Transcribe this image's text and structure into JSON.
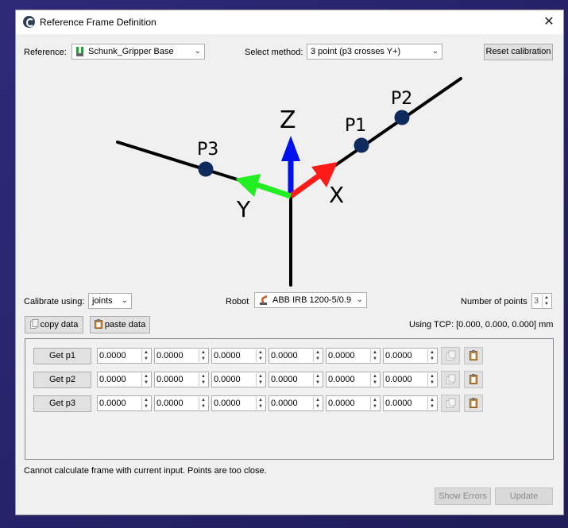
{
  "window": {
    "title": "Reference Frame Definition",
    "close_glyph": "✕"
  },
  "top": {
    "reference_label": "Reference:",
    "reference_value": "Schunk_Gripper Base",
    "method_label": "Select method:",
    "method_value": "3 point (p3 crosses Y+)",
    "reset_label": "Reset calibration"
  },
  "diagram": {
    "axis_labels": {
      "z": "Z",
      "x": "X",
      "y": "Y"
    },
    "point_labels": {
      "p1": "P1",
      "p2": "P2",
      "p3": "P3"
    },
    "colors": {
      "x": "#ff1a1a",
      "y": "#22ee22",
      "z": "#0011ee",
      "point": "#0f2a5c"
    }
  },
  "calibrate": {
    "label": "Calibrate using:",
    "value": "joints",
    "robot_label": "Robot",
    "robot_value": "ABB IRB 1200-5/0.9",
    "points_label": "Number of points",
    "points_value": "3"
  },
  "data_buttons": {
    "copy": "copy data",
    "paste": "paste data"
  },
  "tcp_text": "Using TCP: [0.000, 0.000, 0.000] mm",
  "rows": [
    {
      "button": "Get p1",
      "values": [
        "0.0000",
        "0.0000",
        "0.0000",
        "0.0000",
        "0.0000",
        "0.0000"
      ]
    },
    {
      "button": "Get p2",
      "values": [
        "0.0000",
        "0.0000",
        "0.0000",
        "0.0000",
        "0.0000",
        "0.0000"
      ]
    },
    {
      "button": "Get p3",
      "values": [
        "0.0000",
        "0.0000",
        "0.0000",
        "0.0000",
        "0.0000",
        "0.0000"
      ]
    }
  ],
  "status_message": "Cannot calculate frame with current input. Points are too close.",
  "footer": {
    "show_errors": "Show Errors",
    "update": "Update"
  }
}
